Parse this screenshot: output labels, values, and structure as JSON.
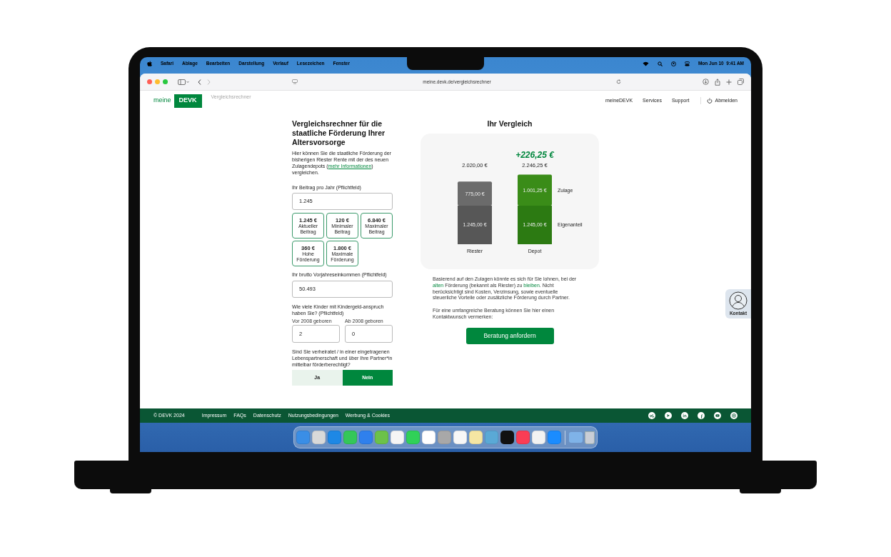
{
  "menu_bar": {
    "app": "Safari",
    "items": [
      "Ablage",
      "Bearbeiten",
      "Darstellung",
      "Verlauf",
      "Lesezeichen",
      "Fenster"
    ],
    "clock": "Mon Jun 10  9:41 AM"
  },
  "browser": {
    "url": "meine.devk.de/vergleichsrechner"
  },
  "site_header": {
    "logo_prefix": "meine",
    "logo_brand": "DEVK",
    "page_label": "Vergleichsrechner",
    "nav": [
      "meineDEVK",
      "Services",
      "Support"
    ],
    "logout": "Abmelden"
  },
  "calculator": {
    "title": "Vergleichsrechner für die staatliche Förderung Ihrer Altersvorsorge",
    "intro": [
      {
        "kind": "text",
        "text": "Hier können Sie die staatliche Förderung der bisherigen Riester Rente mit der des neuen Zulagendepots ("
      },
      {
        "kind": "link",
        "text": "mehr Informationen"
      },
      {
        "kind": "text",
        "text": ") vergleichen."
      }
    ],
    "contribution": {
      "label": "Ihr Beitrag pro Jahr (Pflichtfeld)",
      "value": "1.245"
    },
    "presets": [
      {
        "amount": "1.245 €",
        "label": "Aktueller Beitrag"
      },
      {
        "amount": "120 €",
        "label": "Minimaler Beitrag"
      },
      {
        "amount": "6.840 €",
        "label": "Maximaler Beitrag"
      },
      {
        "amount": "360 €",
        "label": "Hohe Förderung"
      },
      {
        "amount": "1.800 €",
        "label": "Maximale Förderung"
      }
    ],
    "income": {
      "label": "Ihr brutto Vorjahreseinkommen (Pflichtfeld)",
      "value": "50.493"
    },
    "children": {
      "label": "Wie viele Kinder mit Kindergeld-anspruch haben Sie? (Pflichtfeld)",
      "fields": [
        {
          "label": "Vor 2008 geboren",
          "value": "2"
        },
        {
          "label": "Ab 2008 geboren",
          "value": "0"
        }
      ]
    },
    "married": {
      "question": "Sind Sie verheiratet / in einer eingetragenen Lebenspartnerschaft und über Ihre Partner*in mittelbar förderberechtigt?",
      "options": [
        {
          "label": "Ja",
          "selected": false
        },
        {
          "label": "Nein",
          "selected": true
        }
      ]
    }
  },
  "comparison": {
    "title": "Ihr Vergleich",
    "columns": [
      {
        "total": "2.020,00 €"
      },
      {
        "total": "2.246,25 €",
        "difference": "+226,25 €"
      }
    ],
    "chart_data": {
      "type": "bar",
      "stacked": true,
      "categories": [
        "Riester",
        "Depot"
      ],
      "series": [
        {
          "name": "Eigenanteil",
          "colors": [
            "#575757",
            "#2c7a12"
          ],
          "values": [
            1245,
            1245
          ],
          "value_labels": [
            "1.245,00 €",
            "1.245,00 €"
          ]
        },
        {
          "name": "Zulage",
          "colors": [
            "#6b6b6b",
            "#3a8c18"
          ],
          "values": [
            775,
            1001.25
          ],
          "value_labels": [
            "775,00 €",
            "1.001,25 €"
          ]
        }
      ]
    },
    "notice": [
      {
        "kind": "text",
        "text": "Basierend auf den Zulagen könnte es sich für Sie lohnen, bei der "
      },
      {
        "kind": "link",
        "text": "alten"
      },
      {
        "kind": "text",
        "text": " Förderung (bekannt als Riester) zu "
      },
      {
        "kind": "link",
        "text": "bleiben"
      },
      {
        "kind": "text",
        "text": ". Nicht berücksichtigt sind Kosten, Verzinsung, sowie eventuelle steuerliche Vorteile oder zusätzliche Förderung durch Partner."
      }
    ],
    "consult_text": "Für eine umfangreiche Beratung können Sie hier einen Kontaktwunsch vermerken:",
    "button": "Beratung anfordern"
  },
  "contact_widget": {
    "label": "Kontakt"
  },
  "footer": {
    "copyright": "© DEVK 2024",
    "links": [
      "Impressum",
      "FAQs",
      "Datenschutz",
      "Nutzungsbedingungen",
      "Werbung & Cookies"
    ]
  }
}
